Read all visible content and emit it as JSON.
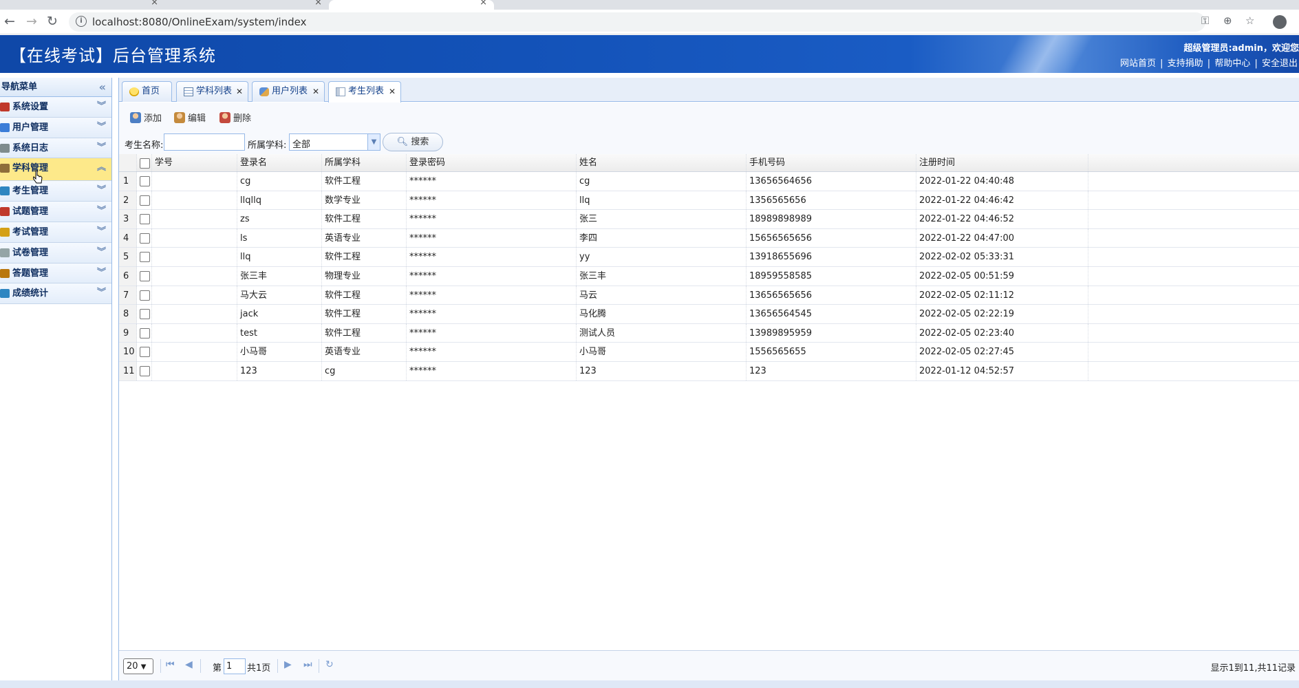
{
  "browser": {
    "url": "localhost:8080/OnlineExam/system/index"
  },
  "banner": {
    "title": "【在线考试】后台管理系统",
    "welcome": "超级管理员:admin，欢迎您",
    "links": [
      "网站首页",
      "支持捐助",
      "帮助中心",
      "安全退出"
    ]
  },
  "sidebar": {
    "header": "导航菜单",
    "items": [
      {
        "label": "系统设置",
        "icon": "tools-icon",
        "color": "#c0392b"
      },
      {
        "label": "用户管理",
        "icon": "users-icon",
        "color": "#3b7dd8"
      },
      {
        "label": "系统日志",
        "icon": "log-icon",
        "color": "#7f8c8d"
      },
      {
        "label": "学科管理",
        "icon": "subject-icon",
        "color": "#8e6e3a",
        "active": true
      },
      {
        "label": "考生管理",
        "icon": "student-icon",
        "color": "#2e86c1"
      },
      {
        "label": "试题管理",
        "icon": "calendar-icon",
        "color": "#c0392b"
      },
      {
        "label": "考试管理",
        "icon": "exam-icon",
        "color": "#d4a017"
      },
      {
        "label": "试卷管理",
        "icon": "paper-icon",
        "color": "#95a5a6"
      },
      {
        "label": "答题管理",
        "icon": "answer-icon",
        "color": "#b9770e"
      },
      {
        "label": "成绩统计",
        "icon": "headset-icon",
        "color": "#2e86c1"
      }
    ]
  },
  "tabs": [
    {
      "label": "首页",
      "icon": "bulb-icon",
      "closable": false
    },
    {
      "label": "学科列表",
      "icon": "table-icon",
      "closable": true
    },
    {
      "label": "用户列表",
      "icon": "users-icon",
      "closable": true
    },
    {
      "label": "考生列表",
      "icon": "card-icon",
      "closable": true,
      "active": true
    }
  ],
  "toolbar": {
    "add": "添加",
    "edit": "编辑",
    "delete": "删除"
  },
  "search": {
    "name_label": "考生名称:",
    "name_value": "",
    "subject_label": "所属学科:",
    "subject_value": "全部",
    "button": "搜索"
  },
  "grid": {
    "columns": [
      "学号",
      "登录名",
      "所属学科",
      "登录密码",
      "姓名",
      "手机号码",
      "注册时间"
    ],
    "rows": [
      {
        "num": "1",
        "sn": "",
        "login": "cg",
        "subject": "软件工程",
        "pwd": "******",
        "name": "cg",
        "phone": "13656564656",
        "time": "2022-01-22 04:40:48"
      },
      {
        "num": "2",
        "sn": "",
        "login": "llqllq",
        "subject": "数学专业",
        "pwd": "******",
        "name": "llq",
        "phone": "1356565656",
        "time": "2022-01-22 04:46:42"
      },
      {
        "num": "3",
        "sn": "",
        "login": "zs",
        "subject": "软件工程",
        "pwd": "******",
        "name": "张三",
        "phone": "18989898989",
        "time": "2022-01-22 04:46:52"
      },
      {
        "num": "4",
        "sn": "",
        "login": "ls",
        "subject": "英语专业",
        "pwd": "******",
        "name": "李四",
        "phone": "15656565656",
        "time": "2022-01-22 04:47:00"
      },
      {
        "num": "5",
        "sn": "",
        "login": "llq",
        "subject": "软件工程",
        "pwd": "******",
        "name": "yy",
        "phone": "13918655696",
        "time": "2022-02-02 05:33:31"
      },
      {
        "num": "6",
        "sn": "",
        "login": "张三丰",
        "subject": "物理专业",
        "pwd": "******",
        "name": "张三丰",
        "phone": "18959558585",
        "time": "2022-02-05 00:51:59"
      },
      {
        "num": "7",
        "sn": "",
        "login": "马大云",
        "subject": "软件工程",
        "pwd": "******",
        "name": "马云",
        "phone": "13656565656",
        "time": "2022-02-05 02:11:12"
      },
      {
        "num": "8",
        "sn": "",
        "login": "jack",
        "subject": "软件工程",
        "pwd": "******",
        "name": "马化腾",
        "phone": "13656564545",
        "time": "2022-02-05 02:22:19"
      },
      {
        "num": "9",
        "sn": "",
        "login": "test",
        "subject": "软件工程",
        "pwd": "******",
        "name": "测试人员",
        "phone": "13989895959",
        "time": "2022-02-05 02:23:40"
      },
      {
        "num": "10",
        "sn": "",
        "login": "小马哥",
        "subject": "英语专业",
        "pwd": "******",
        "name": "小马哥",
        "phone": "1556565655",
        "time": "2022-02-05 02:27:45"
      },
      {
        "num": "11",
        "sn": "",
        "login": "123",
        "subject": "cg",
        "pwd": "******",
        "name": "123",
        "phone": "123",
        "time": "2022-01-12 04:52:57"
      }
    ]
  },
  "pager": {
    "page_size": "20",
    "page_prefix": "第",
    "page_value": "1",
    "page_suffix": "共1页",
    "info": "显示1到11,共11记录"
  }
}
